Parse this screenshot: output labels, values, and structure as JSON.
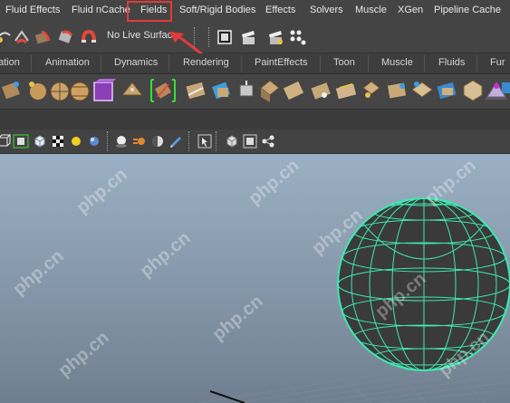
{
  "menu": {
    "items": [
      "Fluid Effects",
      "Fluid nCache",
      "Fields",
      "Soft/Rigid Bodies",
      "Effects",
      "Solvers",
      "Muscle",
      "XGen",
      "Pipeline Cache"
    ]
  },
  "status_line": {
    "live_surface": "No Live Surface"
  },
  "shelf_tabs": [
    "ation",
    "Animation",
    "Dynamics",
    "Rendering",
    "PaintEffects",
    "Toon",
    "Muscle",
    "Fluids",
    "Fur"
  ],
  "watermark": "php.cn",
  "colors": {
    "highlight": "#e23b3b",
    "wireframe": "#3fe8b0",
    "viewport_top": "#9bb0c4",
    "viewport_bottom": "#6f7f90"
  }
}
